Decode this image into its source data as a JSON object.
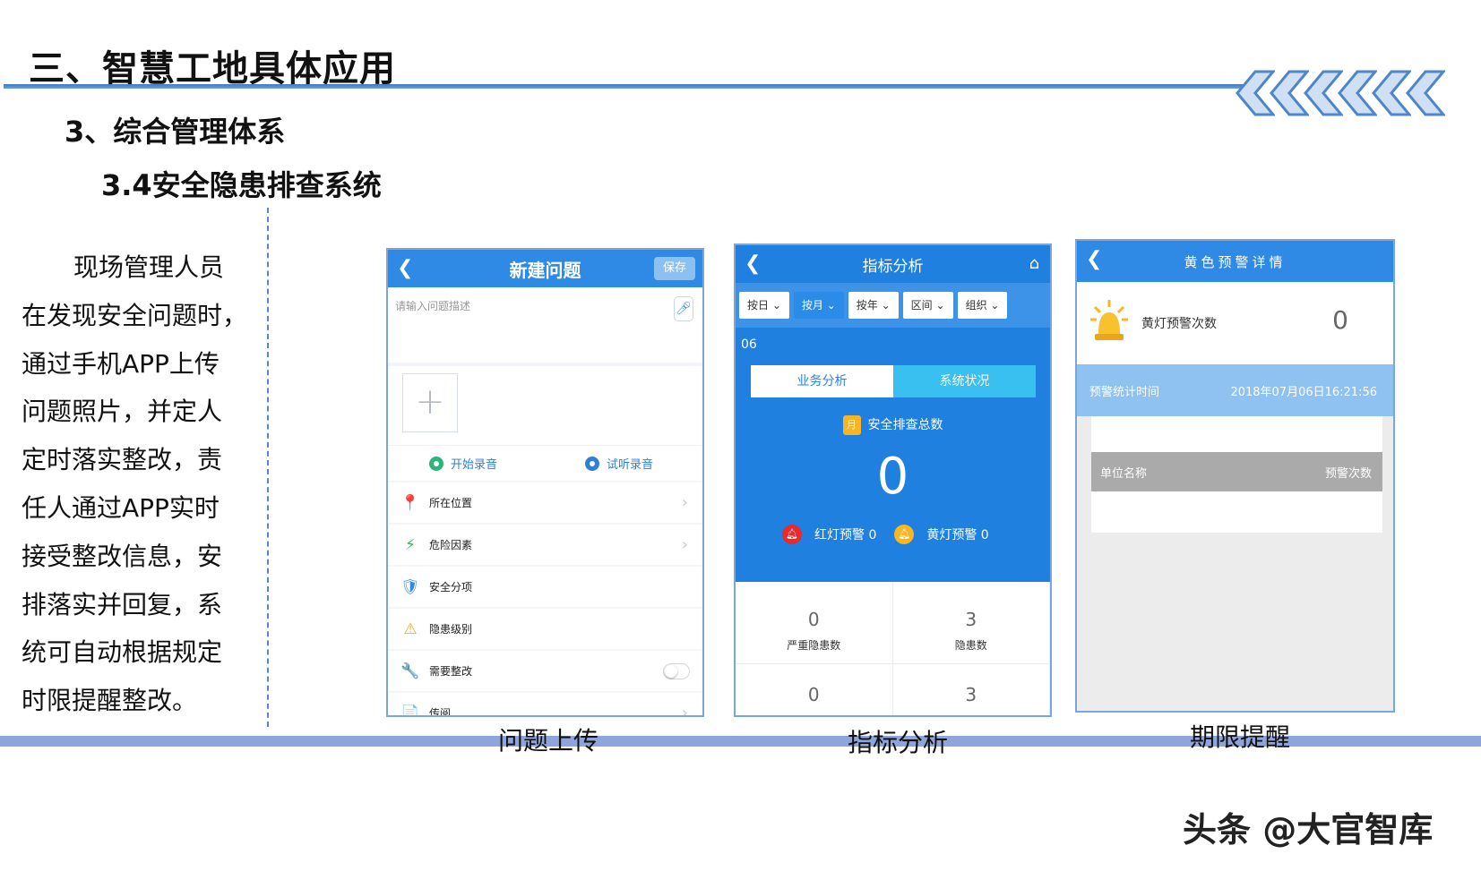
{
  "slide": {
    "title": "三、智慧工地具体应用",
    "subtitle_1": "3、综合管理体系",
    "subtitle_2": "3.4安全隐患排查系统",
    "body_lines": [
      "现场管理人员",
      "在发现安全问题时，",
      "通过手机APP上传",
      "问题照片，并定人",
      "定时落实整改，责",
      "任人通过APP实时",
      "接受整改信息，安",
      "排落实并回复，系",
      "统可自动根据规定",
      "时限提醒整改。"
    ],
    "watermark": "头条 @大官智库",
    "colors": {
      "accent": "#2f8ae6",
      "rule": "#3f78c4",
      "band": "#8ea4db"
    }
  },
  "screens": {
    "upload": {
      "caption": "问题上传",
      "header_title": "新建问题",
      "back_icon": "chevron-left-icon",
      "save_label": "保存",
      "description_placeholder": "请输入问题描述",
      "add_photo_icon": "plus-icon",
      "start_record_label": "开始录音",
      "preview_record_label": "试听录音",
      "items": [
        {
          "icon": "location-pin-icon",
          "glyph": "📍",
          "label": "所在位置"
        },
        {
          "icon": "lightning-icon",
          "glyph": "⚡",
          "label": "危险因素"
        },
        {
          "icon": "shield-icon",
          "glyph": "🛡",
          "label": "安全分项"
        },
        {
          "icon": "warning-icon",
          "glyph": "⚠",
          "label": "隐患级别"
        },
        {
          "icon": "wrench-icon",
          "glyph": "🔧",
          "label": "需要整改"
        },
        {
          "icon": "document-icon",
          "glyph": "📄",
          "label": "传阅"
        }
      ]
    },
    "analysis": {
      "caption": "指标分析",
      "header_title": "指标分析",
      "filters": [
        "按日",
        "按月",
        "按年",
        "区间",
        "组织"
      ],
      "active_filter": "按月",
      "partial_date": "06",
      "tabs": [
        "业务分析",
        "系统状况"
      ],
      "badge_char": "月",
      "total_label": "安全排查总数",
      "total_value": "0",
      "red_warning": "红灯预警 0",
      "yellow_warning": "黄灯预警 0",
      "stats": [
        {
          "value": "0",
          "label": "严重隐患数"
        },
        {
          "value": "3",
          "label": "隐患数"
        },
        {
          "value": "0",
          "label": ""
        },
        {
          "value": "3",
          "label": ""
        }
      ]
    },
    "warning": {
      "caption": "期限提醒",
      "header_title": "黄色预警详情",
      "yellow_count_label": "黄灯预警次数",
      "yellow_count": "0",
      "stat_time_label": "预警统计时间",
      "stat_time_value": "2018年07月06日16:21:56",
      "col_unit": "单位名称",
      "col_count": "预警次数"
    }
  }
}
